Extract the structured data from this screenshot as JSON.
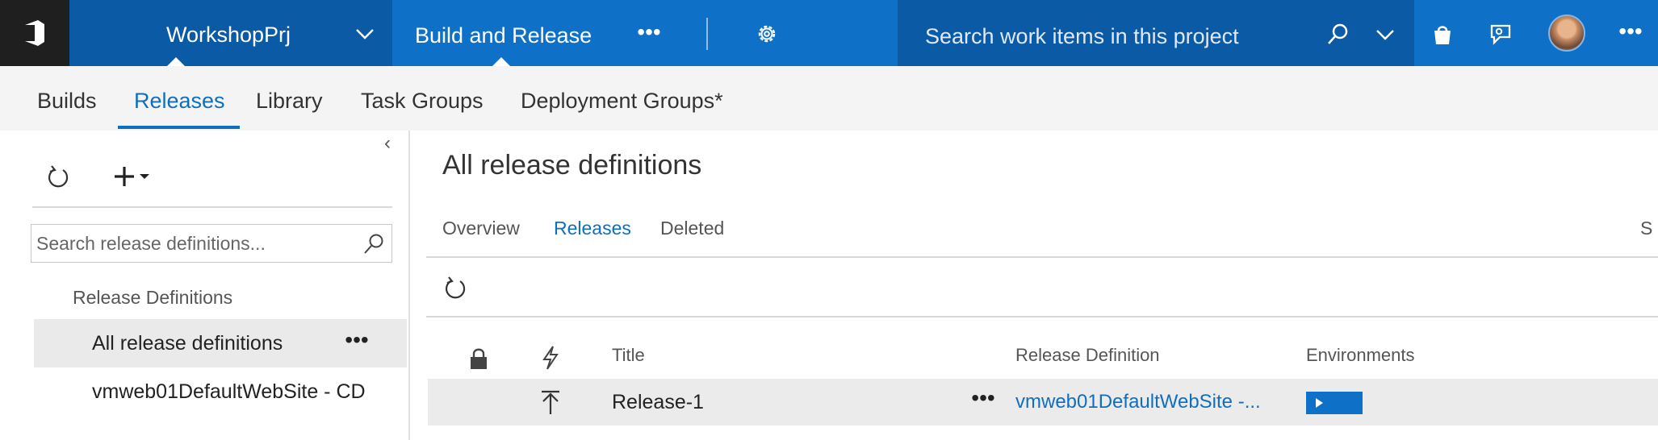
{
  "header": {
    "project_name": "WorkshopPrj",
    "hub_title": "Build and Release",
    "search_placeholder": "Search work items in this project",
    "icons": [
      "vsts-logo-icon",
      "chevron-down-icon",
      "more-icon",
      "gear-icon",
      "search-icon",
      "chevron-down-icon",
      "shopping-bag-icon",
      "feedback-icon",
      "avatar",
      "more-icon"
    ]
  },
  "subnav": {
    "tabs": [
      {
        "label": "Builds",
        "active": false
      },
      {
        "label": "Releases",
        "active": true
      },
      {
        "label": "Library",
        "active": false
      },
      {
        "label": "Task Groups",
        "active": false
      },
      {
        "label": "Deployment Groups*",
        "active": false
      }
    ]
  },
  "left_panel": {
    "collapse_glyph": "‹",
    "search_placeholder": "Search release definitions...",
    "heading": "Release Definitions",
    "items": [
      {
        "label": "All release definitions",
        "selected": true,
        "more": "•••"
      },
      {
        "label": "vmweb01DefaultWebSite - CD",
        "selected": false
      }
    ]
  },
  "main": {
    "title": "All release definitions",
    "tabs": [
      {
        "label": "Overview",
        "active": false
      },
      {
        "label": "Releases",
        "active": true
      },
      {
        "label": "Deleted",
        "active": false
      }
    ],
    "right_cut_text": "S",
    "columns": {
      "title": "Title",
      "release_definition": "Release Definition",
      "environments": "Environments"
    },
    "rows": [
      {
        "title": "Release-1",
        "more": "•••",
        "release_definition": "vmweb01DefaultWebSite -...",
        "environment_status": "in-progress"
      }
    ]
  },
  "glyphs": {
    "more": "•••"
  },
  "colors": {
    "accent": "#0e70c7",
    "header_dark": "#0a5aa5",
    "logo_bg": "#1f1f1f",
    "link": "#106ebe",
    "selected_row": "#eaeaea"
  }
}
